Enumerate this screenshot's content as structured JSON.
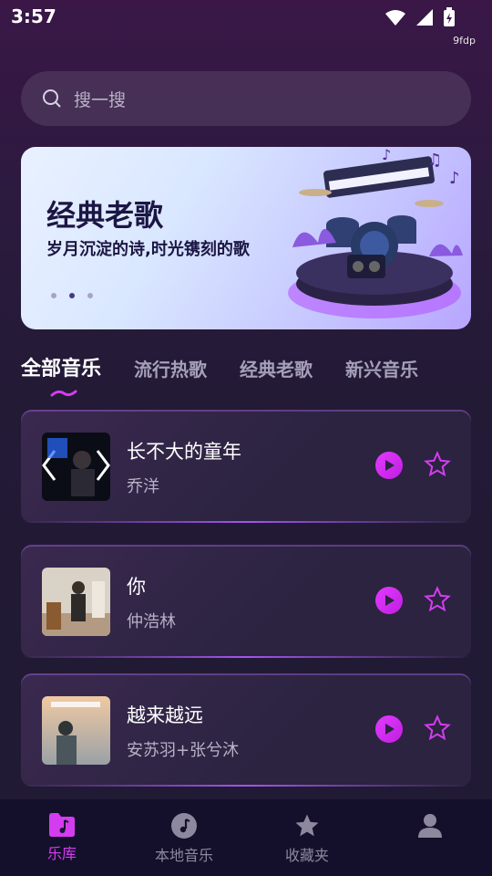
{
  "status": {
    "time": "3:57",
    "tiny": "9fdp"
  },
  "search": {
    "placeholder": "搜一搜"
  },
  "banner": {
    "title": "经典老歌",
    "subtitle": "岁月沉淀的诗,时光镌刻的歌"
  },
  "tabs": [
    {
      "label": "全部音乐"
    },
    {
      "label": "流行热歌"
    },
    {
      "label": "经典老歌"
    },
    {
      "label": "新兴音乐"
    }
  ],
  "songs": [
    {
      "title": "长不大的童年",
      "artist": "乔洋"
    },
    {
      "title": "你",
      "artist": "仲浩林"
    },
    {
      "title": "越来越远",
      "artist": "安苏羽+张兮沐"
    }
  ],
  "nav": [
    {
      "label": "乐库",
      "icon": "music-folder-icon"
    },
    {
      "label": "本地音乐",
      "icon": "disc-icon"
    },
    {
      "label": "收藏夹",
      "icon": "star-icon"
    },
    {
      "label": "",
      "icon": "profile-icon"
    }
  ],
  "colors": {
    "accent": "#d43cf0",
    "nav_bg": "#14102b"
  }
}
